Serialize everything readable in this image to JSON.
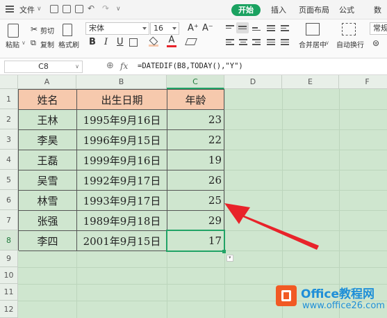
{
  "menu": {
    "file": "文件",
    "tabs": [
      "开始",
      "插入",
      "页面布局",
      "公式",
      "数"
    ]
  },
  "toolbar": {
    "paste": "粘贴",
    "cut": "剪切",
    "copy": "复制",
    "format_painter": "格式刷",
    "font_name": "宋体",
    "font_size": "16",
    "merge_center": "合并居中",
    "wrap_text": "自动换行",
    "number_format": "常规",
    "bold": "B",
    "italic": "I",
    "underline": "U",
    "font_color_glyph": "A",
    "grow_font": "A⁺",
    "shrink_font": "A⁻"
  },
  "formula_bar": {
    "name_box": "C8",
    "fx": "fx",
    "formula": "=DATEDIF(B8,TODAY(),\"Y\")"
  },
  "sheet": {
    "columns": [
      "A",
      "B",
      "C",
      "D",
      "E",
      "F"
    ],
    "rows": [
      "1",
      "2",
      "3",
      "4",
      "5",
      "6",
      "7",
      "8",
      "9",
      "10",
      "11",
      "12"
    ],
    "selected_cell": "C8",
    "headers": [
      "姓名",
      "出生日期",
      "年龄"
    ],
    "data": [
      {
        "name": "王林",
        "birth": "1995年9月16日",
        "age": "23"
      },
      {
        "name": "李昊",
        "birth": "1996年9月15日",
        "age": "22"
      },
      {
        "name": "王磊",
        "birth": "1999年9月16日",
        "age": "19"
      },
      {
        "name": "吴雪",
        "birth": "1992年9月17日",
        "age": "26"
      },
      {
        "name": "林雪",
        "birth": "1993年9月17日",
        "age": "25"
      },
      {
        "name": "张强",
        "birth": "1989年9月18日",
        "age": "29"
      },
      {
        "name": "李四",
        "birth": "2001年9月15日",
        "age": "17"
      }
    ]
  },
  "colors": {
    "accent": "#1aa260",
    "header_fill": "#f6c9ad",
    "sheet_bg": "#cfe6cf",
    "arrow": "#e8232a"
  },
  "watermark": {
    "title": "Office教程网",
    "url": "www.office26.com"
  }
}
